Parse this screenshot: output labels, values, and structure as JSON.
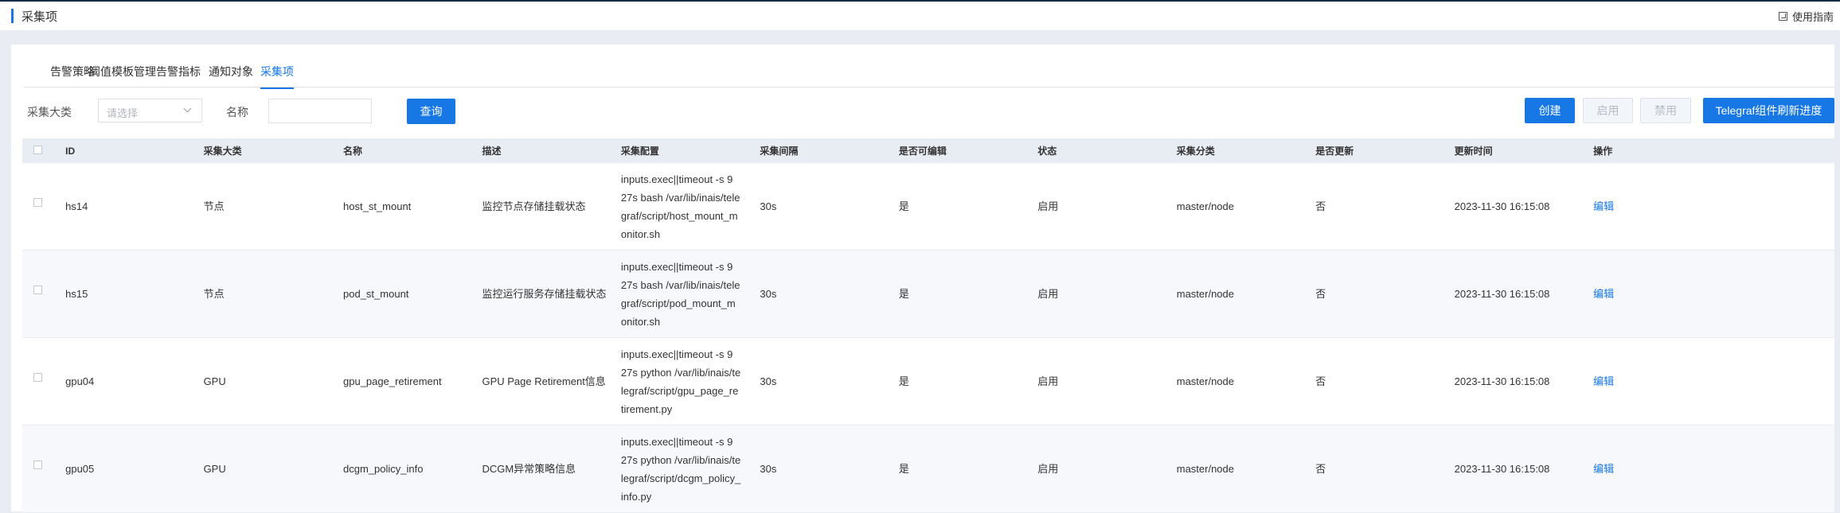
{
  "header": {
    "title": "采集项",
    "guide_label": "使用指南"
  },
  "tabs": [
    {
      "label": "告警策略",
      "active": false
    },
    {
      "label": "阈值模板管理",
      "active": false
    },
    {
      "label": "告警指标",
      "active": false
    },
    {
      "label": "通知对象",
      "active": false
    },
    {
      "label": "采集项",
      "active": true
    }
  ],
  "filter": {
    "category_label": "采集大类",
    "category_placeholder": "请选择",
    "name_label": "名称",
    "name_value": "",
    "query_button": "查询"
  },
  "actions": {
    "create": "创建",
    "enable": "启用",
    "disable": "禁用",
    "refresh": "Telegraf组件刷新进度"
  },
  "table": {
    "columns": [
      "ID",
      "采集大类",
      "名称",
      "描述",
      "采集配置",
      "采集间隔",
      "是否可编辑",
      "状态",
      "采集分类",
      "是否更新",
      "更新时间",
      "操作"
    ],
    "rows": [
      {
        "id": "hs14",
        "category": "节点",
        "name": "host_st_mount",
        "desc": "监控节点存储挂载状态",
        "config": "inputs.exec||timeout -s 9 27s bash /var/lib/inais/telegraf/script/host_mount_monitor.sh",
        "interval": "30s",
        "editable": "是",
        "status": "启用",
        "classification": "master/node",
        "updated": "否",
        "update_time": "2023-11-30 16:15:08",
        "action": "编辑"
      },
      {
        "id": "hs15",
        "category": "节点",
        "name": "pod_st_mount",
        "desc": "监控运行服务存储挂载状态",
        "config": "inputs.exec||timeout -s 9 27s bash /var/lib/inais/telegraf/script/pod_mount_monitor.sh",
        "interval": "30s",
        "editable": "是",
        "status": "启用",
        "classification": "master/node",
        "updated": "否",
        "update_time": "2023-11-30 16:15:08",
        "action": "编辑"
      },
      {
        "id": "gpu04",
        "category": "GPU",
        "name": "gpu_page_retirement",
        "desc": "GPU Page Retirement信息",
        "config": "inputs.exec||timeout -s 9 27s python /var/lib/inais/telegraf/script/gpu_page_retirement.py",
        "interval": "30s",
        "editable": "是",
        "status": "启用",
        "classification": "master/node",
        "updated": "否",
        "update_time": "2023-11-30 16:15:08",
        "action": "编辑"
      },
      {
        "id": "gpu05",
        "category": "GPU",
        "name": "dcgm_policy_info",
        "desc": "DCGM异常策略信息",
        "config": "inputs.exec||timeout -s 9 27s python /var/lib/inais/telegraf/script/dcgm_policy_info.py",
        "interval": "30s",
        "editable": "是",
        "status": "启用",
        "classification": "master/node",
        "updated": "否",
        "update_time": "2023-11-30 16:15:08",
        "action": "编辑"
      }
    ]
  }
}
